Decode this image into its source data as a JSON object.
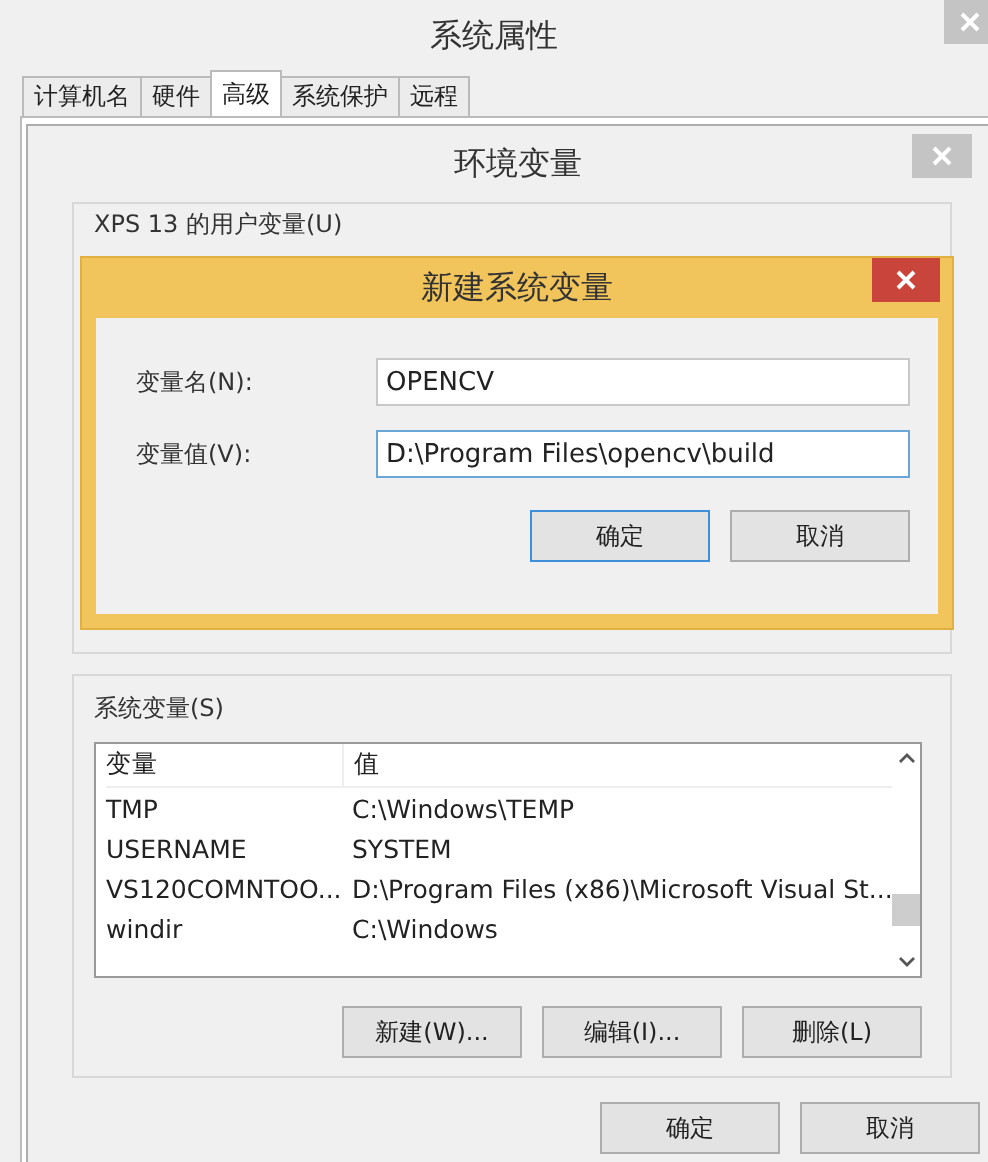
{
  "window": {
    "title": "系统属性"
  },
  "tabs": [
    {
      "label": "计算机名",
      "selected": false
    },
    {
      "label": "硬件",
      "selected": false
    },
    {
      "label": "高级",
      "selected": true
    },
    {
      "label": "系统保护",
      "selected": false
    },
    {
      "label": "远程",
      "selected": false
    }
  ],
  "env_window": {
    "title": "环境变量",
    "user_section_label": "XPS 13 的用户变量(U)",
    "system_section_label": "系统变量(S)",
    "columns": [
      "变量",
      "值"
    ],
    "rows": [
      {
        "name": "TMP",
        "value": "C:\\Windows\\TEMP"
      },
      {
        "name": "USERNAME",
        "value": "SYSTEM"
      },
      {
        "name": "VS120COMNTOO...",
        "value": "D:\\Program Files (x86)\\Microsoft Visual St..."
      },
      {
        "name": "windir",
        "value": "C:\\Windows"
      }
    ],
    "buttons": [
      "新建(W)...",
      "编辑(I)...",
      "删除(L)"
    ],
    "footer_buttons": [
      "确定",
      "取消"
    ]
  },
  "dialog": {
    "title": "新建系统变量",
    "fields": [
      {
        "label": "变量名(N):",
        "value": "OPENCV",
        "focused": false
      },
      {
        "label": "变量值(V):",
        "value": "D:\\Program Files\\opencv\\build",
        "focused": true
      }
    ],
    "buttons": [
      {
        "label": "确定",
        "default": true
      },
      {
        "label": "取消",
        "default": false
      }
    ]
  }
}
